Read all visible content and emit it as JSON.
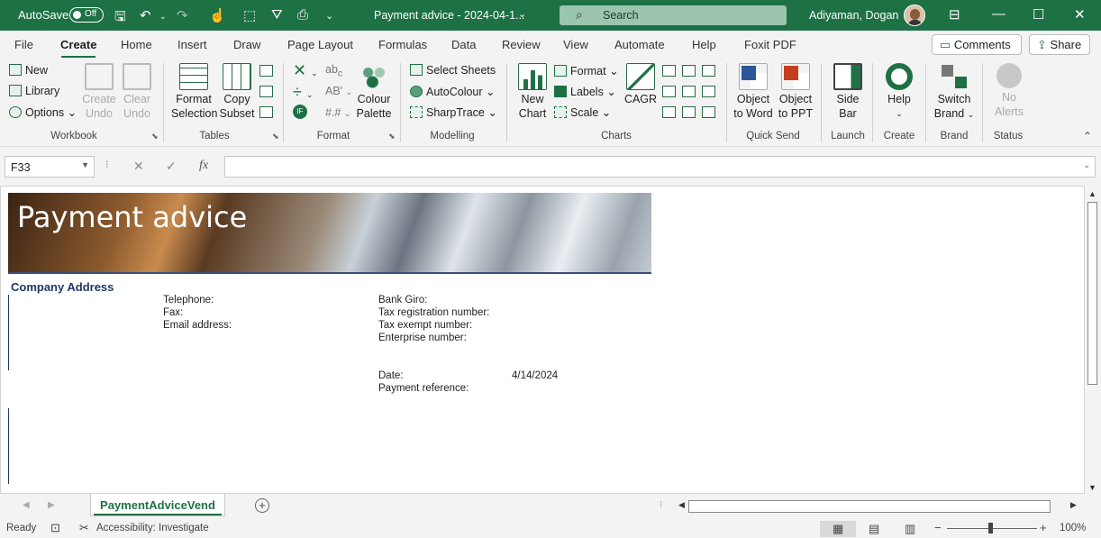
{
  "titlebar": {
    "autosave_label": "AutoSave",
    "autosave_state": "Off",
    "doc_title": "Payment advice - 2024-04-1...",
    "search_placeholder": "Search",
    "user_name": "Adiyaman, Dogan"
  },
  "tabs": [
    "File",
    "Create",
    "Home",
    "Insert",
    "Draw",
    "Page Layout",
    "Formulas",
    "Data",
    "Review",
    "View",
    "Automate",
    "Help",
    "Foxit PDF"
  ],
  "active_tab": "Create",
  "tab_buttons": {
    "comments": "Comments",
    "share": "Share"
  },
  "ribbon": {
    "workbook": {
      "label": "Workbook",
      "new": "New",
      "library": "Library",
      "options": "Options",
      "create_undo": [
        "Create",
        "Undo"
      ],
      "clear_undo": [
        "Clear",
        "Undo"
      ]
    },
    "tables": {
      "label": "Tables",
      "format_selection": [
        "Format",
        "Selection"
      ],
      "copy_subset": [
        "Copy",
        "Subset"
      ]
    },
    "format": {
      "label": "Format",
      "colour_palette": [
        "Colour",
        "Palette"
      ]
    },
    "modelling": {
      "label": "Modelling",
      "select_sheets": "Select Sheets",
      "autocolour": "AutoColour",
      "sharptrace": "SharpTrace"
    },
    "charts": {
      "label": "Charts",
      "new_chart": [
        "New",
        "Chart"
      ],
      "format": "Format",
      "labels": "Labels",
      "scale": "Scale",
      "cagr": "CAGR"
    },
    "quick_send": {
      "label": "Quick Send",
      "object_to_word": [
        "Object",
        "to Word"
      ],
      "object_to_ppt": [
        "Object",
        "to PPT"
      ]
    },
    "launch": {
      "label": "Launch",
      "side_bar": [
        "Side",
        "Bar"
      ]
    },
    "create": {
      "label": "Create",
      "help": "Help"
    },
    "brand": {
      "label": "Brand",
      "switch_brand": [
        "Switch",
        "Brand"
      ]
    },
    "status": {
      "label": "Status",
      "no_alerts": [
        "No",
        "Alerts"
      ]
    }
  },
  "formula_bar": {
    "name_box": "F33",
    "fx": "fx",
    "value": ""
  },
  "sheet": {
    "banner_title": "Payment advice",
    "company_address": "Company Address",
    "telephone": "Telephone:",
    "fax": "Fax:",
    "email": "Email address:",
    "bank_giro": "Bank Giro:",
    "tax_reg": "Tax registration number:",
    "tax_exempt": "Tax exempt number:",
    "enterprise": "Enterprise number:",
    "date_label": "Date:",
    "date_value": "4/14/2024",
    "payment_ref": "Payment reference:"
  },
  "sheet_tab": "PaymentAdviceVend",
  "statusbar": {
    "ready": "Ready",
    "accessibility": "Accessibility: Investigate",
    "zoom": "100%"
  },
  "colors": {
    "brand": "#1e7145",
    "header_text": "#1f3864"
  }
}
